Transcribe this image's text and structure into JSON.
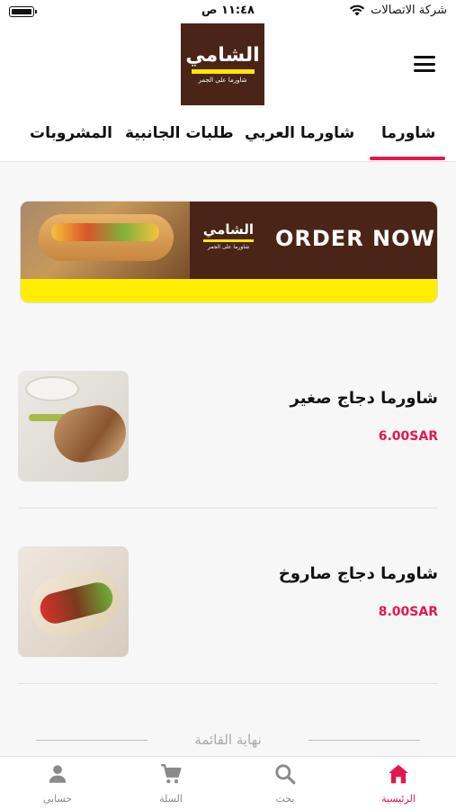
{
  "status_bar": {
    "carrier": "شركة الاتصالات",
    "time": "١١:٤٨ ص"
  },
  "header": {
    "logo": {
      "title": "الشامي",
      "subtitle": "شاورما على الجمر"
    },
    "menu_icon": "hamburger-menu-icon"
  },
  "tabs": [
    {
      "label": "شاورما",
      "active": true
    },
    {
      "label": "شاورما العربي",
      "active": false
    },
    {
      "label": "طلبات الجانبية",
      "active": false
    },
    {
      "label": "المشروبات",
      "active": false
    }
  ],
  "banner": {
    "brand": "الشامي",
    "brand_subtitle": "شاورما على الجمر",
    "cta": "ORDER NOW"
  },
  "products": [
    {
      "name": "شاورما دجاج صغير",
      "price": "6.00SAR"
    },
    {
      "name": "شاورما دجاج صاروخ",
      "price": "8.00SAR"
    }
  ],
  "end_of_list": "نهاية القائمة",
  "bottom_nav": [
    {
      "label": "الرئيسية",
      "icon": "home-icon",
      "active": true
    },
    {
      "label": "بحث",
      "icon": "search-icon",
      "active": false
    },
    {
      "label": "السلة",
      "icon": "cart-icon",
      "active": false
    },
    {
      "label": "حسابي",
      "icon": "person-icon",
      "active": false
    }
  ],
  "colors": {
    "accent": "#e4174c",
    "brand_brown": "#4a2416",
    "brand_yellow": "#ffe600"
  }
}
